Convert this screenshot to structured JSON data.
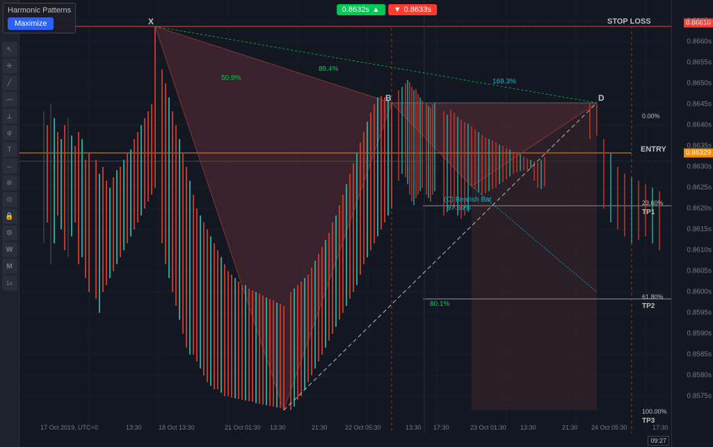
{
  "widget": {
    "title": "Harmonic Patterns",
    "maximize_label": "Maximize"
  },
  "prices": {
    "bid": "0.8632s",
    "ask": "0.8633s",
    "stop_loss": "0.86610",
    "entry": "0.86329",
    "tp1_level": "23.60%",
    "tp1_label": "TP1",
    "tp2_level": "61.80%",
    "tp2_label": "TP2",
    "tp3_level": "100.00%",
    "tp3_label": "TP3",
    "entry_pct": "0.00%",
    "labels": {
      "stop_loss": "STOP LOSS",
      "entry": "ENTRY"
    }
  },
  "pattern": {
    "name": "(C) Bearish Bat",
    "ratio": "97.69%",
    "point_x": "X",
    "point_b": "B",
    "point_d": "D",
    "ratios": {
      "r1": "50.9%",
      "r2": "89.4%",
      "r3": "169.3%",
      "r4": "80.1%"
    }
  },
  "time_labels": [
    "17 Oct 2019, UTC+0",
    "13:30",
    "18 Oct 13:30",
    "21 Oct 01:30",
    "13:30",
    "21:30",
    "22 Oct 05:30",
    "13:30",
    "17:30",
    "23 Oct 01:30",
    "13:30",
    "21:30",
    "24 Oct 05:30",
    "17:30"
  ],
  "toolbar_icons": [
    "cursor",
    "crosshair",
    "line",
    "hline",
    "channel",
    "fib",
    "text",
    "measure",
    "zoom",
    "magnet",
    "lock",
    "settings"
  ],
  "price_scale": [
    "0.8665s",
    "0.8660s",
    "0.8655s",
    "0.8650s",
    "0.8645s",
    "0.8640s",
    "0.8635s",
    "0.8630s",
    "0.8625s",
    "0.8620s",
    "0.8615s",
    "0.8610s",
    "0.8605s",
    "0.8600s",
    "0.8595s",
    "0.8590s",
    "0.8585s",
    "0.8580s",
    "0.8575s"
  ],
  "colors": {
    "green": "#00c853",
    "red": "#ff3b30",
    "orange": "#ff8c00",
    "teal": "#00bcd4",
    "pattern_fill": "rgba(220,100,100,0.25)",
    "pattern_stroke": "rgba(220,80,80,0.7)"
  },
  "bottom_timestamp": "09:27"
}
